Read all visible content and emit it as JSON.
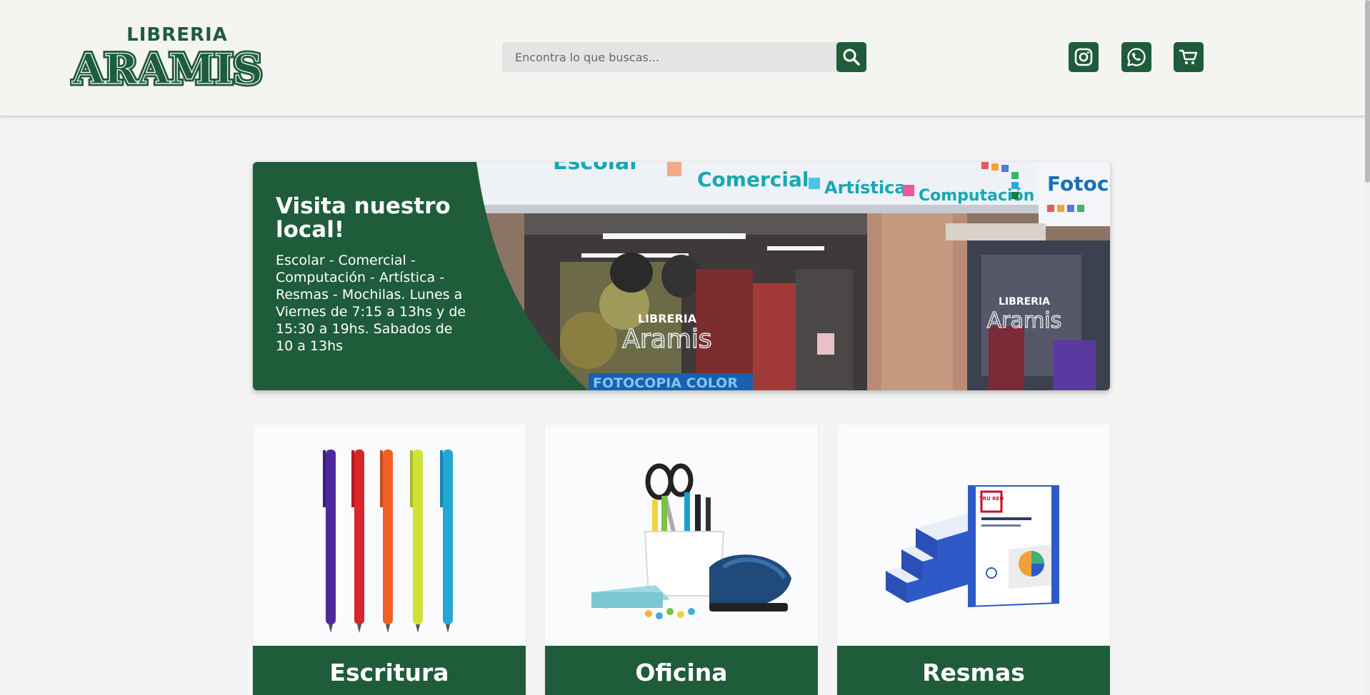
{
  "brand": {
    "logo_small": "LIBRERIA",
    "logo_large": "ARAMIS",
    "color_primary": "#1f5c3a"
  },
  "search": {
    "placeholder": "Encontra lo que buscas...",
    "button_icon": "search-icon"
  },
  "header_icons": [
    {
      "name": "instagram-icon"
    },
    {
      "name": "whatsapp-icon"
    },
    {
      "name": "cart-icon"
    }
  ],
  "banner": {
    "title": "Visita nuestro local!",
    "text": "Escolar - Comercial - Computación - Artística - Resmas - Mochilas. Lunes a Viernes de 7:15 a 13hs y de 15:30 a 19hs. Sabados de 10 a 13hs",
    "storefront_sign": [
      "Escolar",
      "Comercial",
      "Artística",
      "Computación",
      "Fotocop"
    ],
    "window_logo_small": "LIBRERIA",
    "window_logo_large": "Aramis",
    "window_banner": "FOTOCOPIA COLOR"
  },
  "categories": [
    {
      "label": "Escritura"
    },
    {
      "label": "Oficina"
    },
    {
      "label": "Resmas"
    }
  ],
  "resma_box_brand": "TRU RED"
}
